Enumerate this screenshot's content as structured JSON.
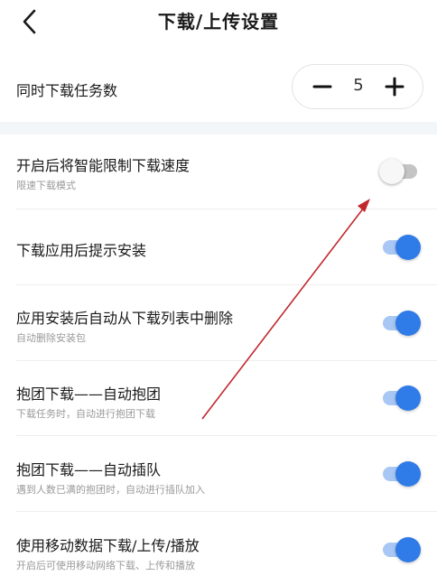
{
  "header": {
    "title": "下载/上传设置",
    "back_icon": "chevron-left-icon"
  },
  "concurrent": {
    "label": "同时下载任务数",
    "value": "5",
    "minus_icon": "minus-icon",
    "plus_icon": "plus-icon"
  },
  "settings": [
    {
      "label": "开启后将智能限制下载速度",
      "sub": "限速下载模式",
      "on": false
    },
    {
      "label": "下载应用后提示安装",
      "sub": "",
      "on": true
    },
    {
      "label": "应用安装后自动从下载列表中删除",
      "sub": "自动删除安装包",
      "on": true
    },
    {
      "label": "抱团下载——自动抱团",
      "sub": "下载任务时，自动进行抱团下载",
      "on": true
    },
    {
      "label": "抱团下载——自动插队",
      "sub": "遇到人数已满的抱团时，自动进行插队加入",
      "on": true
    },
    {
      "label": "使用移动数据下载/上传/播放",
      "sub": "开启后可使用移动网络下载、上传和播放",
      "on": true
    }
  ],
  "colors": {
    "accent": "#2f7be7",
    "accent_track": "#a9c7f4",
    "off_track": "#c4c4c4",
    "annotation_arrow": "#c0282d"
  }
}
